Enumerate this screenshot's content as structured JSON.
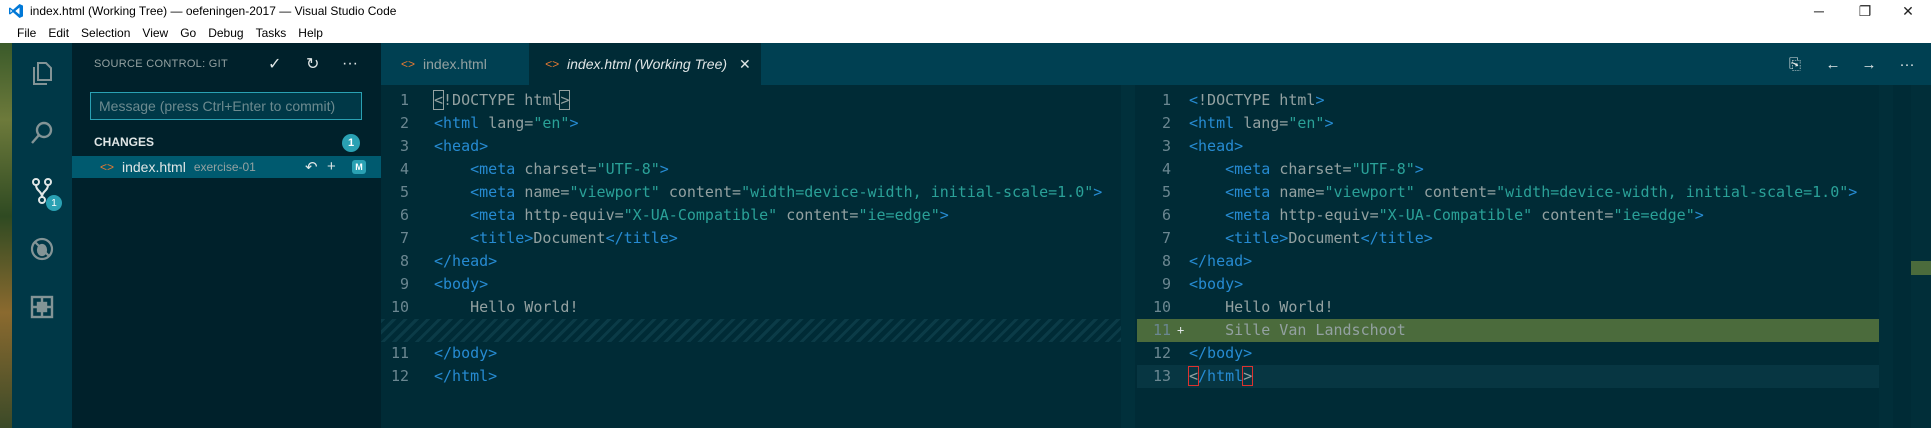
{
  "window": {
    "title": "index.html (Working Tree) — oefeningen-2017 — Visual Studio Code",
    "controls": [
      "─",
      "❐",
      "✕"
    ]
  },
  "menu": [
    "File",
    "Edit",
    "Selection",
    "View",
    "Go",
    "Debug",
    "Tasks",
    "Help"
  ],
  "activity_bar": {
    "items": [
      "files-icon",
      "search-icon",
      "source-control-icon",
      "debug-icon",
      "extensions-icon"
    ],
    "source_control_badge": "1"
  },
  "sidebar": {
    "title": "SOURCE CONTROL: GIT",
    "actions": {
      "commit": "✓",
      "refresh": "↻",
      "more": "···"
    },
    "commit_placeholder": "Message (press Ctrl+Enter to commit)",
    "changes_label": "CHANGES",
    "changes_count": "1",
    "change": {
      "file": "index.html",
      "folder": "exercise-01",
      "icon": "<>",
      "discard": "↶",
      "stage": "+",
      "status": "M"
    }
  },
  "tabs": [
    {
      "label": "index.html",
      "icon": "<>",
      "active": false
    },
    {
      "label": "index.html (Working Tree)",
      "icon": "<>",
      "active": true,
      "close": "✕"
    }
  ],
  "editor_actions": {
    "open_file": "⎘",
    "prev_change": "←",
    "next_change": "→",
    "more": "···"
  },
  "left_editor": {
    "lines": [
      {
        "no": "1",
        "html": "<span class='bracket'>&lt;</span><span class='txt'>!DOCTYPE html</span><span class='bracket'>&gt;</span>"
      },
      {
        "no": "2",
        "html": "<span class='tag'>&lt;html</span> <span class='attr'>lang=</span><span class='str'>\"en\"</span><span class='tag'>&gt;</span>"
      },
      {
        "no": "3",
        "html": "<span class='tag'>&lt;head&gt;</span>"
      },
      {
        "no": "4",
        "html": "    <span class='tag'>&lt;meta</span> <span class='attr'>charset=</span><span class='str'>\"UTF-8\"</span><span class='tag'>&gt;</span>"
      },
      {
        "no": "5",
        "html": "    <span class='tag'>&lt;meta</span> <span class='attr'>name=</span><span class='str'>\"viewport\"</span> <span class='attr'>content=</span><span class='str'>\"width=device-width, initial-scale=1.0\"</span><span class='tag'>&gt;</span>"
      },
      {
        "no": "6",
        "html": "    <span class='tag'>&lt;meta</span> <span class='attr'>http-equiv=</span><span class='str'>\"X-UA-Compatible\"</span> <span class='attr'>content=</span><span class='str'>\"ie=edge\"</span><span class='tag'>&gt;</span>"
      },
      {
        "no": "7",
        "html": "    <span class='tag'>&lt;title&gt;</span><span class='txt'>Document</span><span class='tag'>&lt;/title&gt;</span>"
      },
      {
        "no": "8",
        "html": "<span class='tag'>&lt;/head&gt;</span>"
      },
      {
        "no": "9",
        "html": "<span class='tag'>&lt;body&gt;</span>"
      },
      {
        "no": "10",
        "html": "    <span class='txt'>Hello World!</span>"
      },
      {
        "no": "",
        "html": "",
        "kind": "filler"
      },
      {
        "no": "11",
        "html": "<span class='tag'>&lt;/body&gt;</span>"
      },
      {
        "no": "12",
        "html": "<span class='tag'>&lt;/html&gt;</span>"
      }
    ]
  },
  "right_editor": {
    "lines": [
      {
        "no": "1",
        "html": "<span class='tag'>&lt;</span><span class='txt'>!DOCTYPE html</span><span class='tag'>&gt;</span>"
      },
      {
        "no": "2",
        "html": "<span class='tag'>&lt;html</span> <span class='attr'>lang=</span><span class='str'>\"en\"</span><span class='tag'>&gt;</span>"
      },
      {
        "no": "3",
        "html": "<span class='tag'>&lt;head&gt;</span>"
      },
      {
        "no": "4",
        "html": "    <span class='tag'>&lt;meta</span> <span class='attr'>charset=</span><span class='str'>\"UTF-8\"</span><span class='tag'>&gt;</span>"
      },
      {
        "no": "5",
        "html": "    <span class='tag'>&lt;meta</span> <span class='attr'>name=</span><span class='str'>\"viewport\"</span> <span class='attr'>content=</span><span class='str'>\"width=device-width, initial-scale=1.0\"</span><span class='tag'>&gt;</span>"
      },
      {
        "no": "6",
        "html": "    <span class='tag'>&lt;meta</span> <span class='attr'>http-equiv=</span><span class='str'>\"X-UA-Compatible\"</span> <span class='attr'>content=</span><span class='str'>\"ie=edge\"</span><span class='tag'>&gt;</span>"
      },
      {
        "no": "7",
        "html": "    <span class='tag'>&lt;title&gt;</span><span class='txt'>Document</span><span class='tag'>&lt;/title&gt;</span>"
      },
      {
        "no": "8",
        "html": "<span class='tag'>&lt;/head&gt;</span>"
      },
      {
        "no": "9",
        "html": "<span class='tag'>&lt;body&gt;</span>"
      },
      {
        "no": "10",
        "html": "    <span class='txt'>Hello World!</span>"
      },
      {
        "no": "11",
        "html": "    <span class='txt'>Sille Van Landschoot</span>",
        "kind": "inserted",
        "marker": "+"
      },
      {
        "no": "12",
        "html": "<span class='tag'>&lt;/body&gt;</span>"
      },
      {
        "no": "13",
        "html": "<span class='bracket-red'>&lt;</span><span class='tag'>/html</span><span class='bracket-red'>&gt;</span>",
        "kind": "current"
      }
    ]
  }
}
